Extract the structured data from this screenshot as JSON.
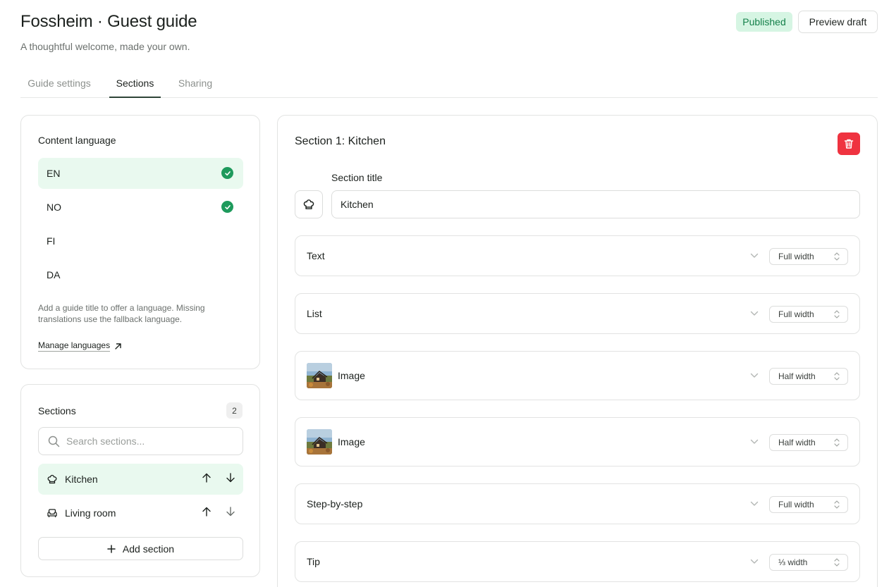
{
  "header": {
    "title": "Fossheim · Guest guide",
    "subtitle": "A thoughtful welcome, made your own.",
    "status_badge": "Published",
    "preview_button": "Preview draft"
  },
  "tabs": [
    {
      "label": "Guide settings",
      "active": false
    },
    {
      "label": "Sections",
      "active": true
    },
    {
      "label": "Sharing",
      "active": false
    }
  ],
  "content_language": {
    "heading": "Content language",
    "languages": [
      {
        "code": "EN",
        "selected": true,
        "complete": true
      },
      {
        "code": "NO",
        "selected": false,
        "complete": true
      },
      {
        "code": "FI",
        "selected": false,
        "complete": false
      },
      {
        "code": "DA",
        "selected": false,
        "complete": false
      }
    ],
    "help_text": "Add a guide title to offer a language. Missing translations use the fallback language.",
    "manage_link": "Manage languages"
  },
  "sections_panel": {
    "heading": "Sections",
    "count": "2",
    "search_placeholder": "Search sections...",
    "items": [
      {
        "label": "Kitchen",
        "icon": "chef-hat-icon",
        "selected": true
      },
      {
        "label": "Living room",
        "icon": "sofa-icon",
        "selected": false
      }
    ],
    "add_button": "Add section"
  },
  "editor": {
    "title": "Section 1: Kitchen",
    "field_label": "Section title",
    "title_value": "Kitchen",
    "icon": "chef-hat-icon",
    "blocks": [
      {
        "label": "Text",
        "width": "Full width",
        "thumbnail": false
      },
      {
        "label": "List",
        "width": "Full width",
        "thumbnail": false
      },
      {
        "label": "Image",
        "width": "Half width",
        "thumbnail": true
      },
      {
        "label": "Image",
        "width": "Half width",
        "thumbnail": true
      },
      {
        "label": "Step-by-step",
        "width": "Full width",
        "thumbnail": false
      },
      {
        "label": "Tip",
        "width": "⅓ width",
        "thumbnail": false
      }
    ]
  },
  "colors": {
    "accent_green": "#1e9a5c",
    "selected_bg": "#e9f9ef",
    "delete_red": "#ef3340",
    "published_bg": "#d6f5e3"
  }
}
